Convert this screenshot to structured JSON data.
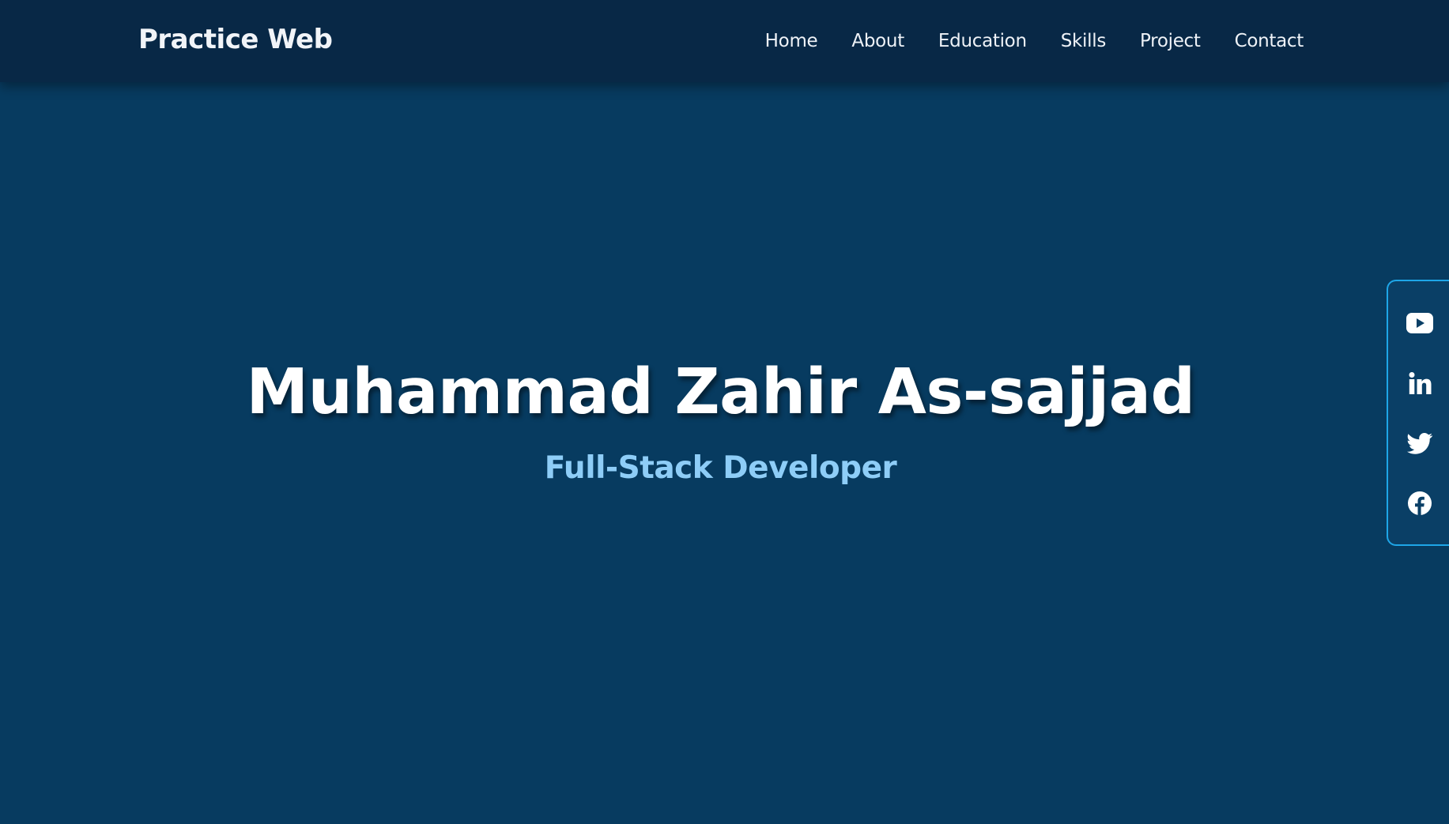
{
  "navbar": {
    "brand": "Practice Web",
    "links": [
      {
        "label": "Home"
      },
      {
        "label": "About"
      },
      {
        "label": "Education"
      },
      {
        "label": "Skills"
      },
      {
        "label": "Project"
      },
      {
        "label": "Contact"
      }
    ]
  },
  "hero": {
    "name": "Muhammad Zahir As-sajjad",
    "role": "Full-Stack Developer"
  },
  "social": {
    "items": [
      {
        "icon": "youtube-icon"
      },
      {
        "icon": "linkedin-icon"
      },
      {
        "icon": "twitter-icon"
      },
      {
        "icon": "facebook-icon"
      }
    ]
  },
  "colors": {
    "background": "#073b60",
    "navbar": "#082846",
    "accent": "#8ecdf7",
    "social_border": "#1ea6e8"
  }
}
